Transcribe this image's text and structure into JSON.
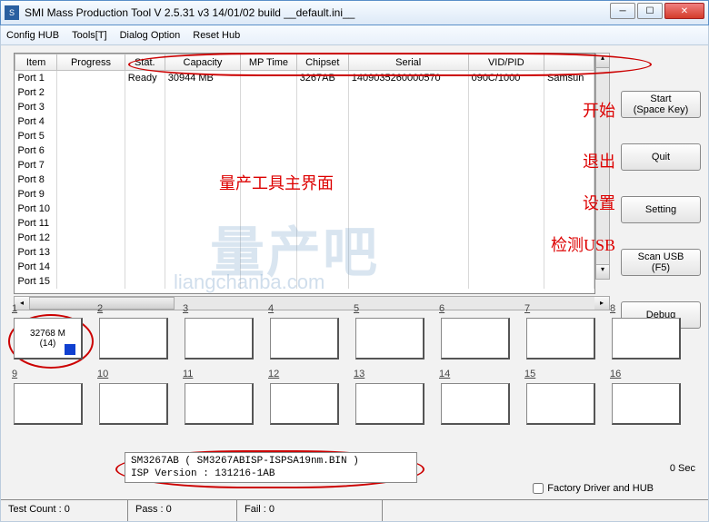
{
  "window": {
    "title": "SMI Mass Production Tool        V 2.5.31   v3        14/01/02 build        __default.ini__"
  },
  "menu": {
    "config_hub": "Config HUB",
    "tools": "Tools[T]",
    "dialog_option": "Dialog Option",
    "reset_hub": "Reset Hub"
  },
  "table": {
    "headers": [
      "Item",
      "Progress",
      "Stat.",
      "Capacity",
      "MP Time",
      "Chipset",
      "Serial",
      "VID/PID",
      ""
    ],
    "rows": [
      {
        "item": "Port 1",
        "progress": "",
        "stat": "Ready",
        "capacity": "30944 MB",
        "mp_time": "",
        "chipset": "3267AB",
        "serial": "1409035260000570",
        "vidpid": "090C/1000",
        "extra": "Samsun"
      },
      {
        "item": "Port 2"
      },
      {
        "item": "Port 3"
      },
      {
        "item": "Port 4"
      },
      {
        "item": "Port 5"
      },
      {
        "item": "Port 6"
      },
      {
        "item": "Port 7"
      },
      {
        "item": "Port 8"
      },
      {
        "item": "Port 9"
      },
      {
        "item": "Port 10"
      },
      {
        "item": "Port 11"
      },
      {
        "item": "Port 12"
      },
      {
        "item": "Port 13"
      },
      {
        "item": "Port 14"
      },
      {
        "item": "Port 15"
      }
    ]
  },
  "annotations": {
    "main_ui": "量产工具主界面",
    "start": "开始",
    "quit": "退出",
    "setting": "设置",
    "scan": "检测USB"
  },
  "buttons": {
    "start": "Start\n(Space Key)",
    "quit": "Quit",
    "setting": "Setting",
    "scan": "Scan USB\n(F5)",
    "debug": "Debug"
  },
  "slots": {
    "numbers": [
      "1",
      "2",
      "3",
      "4",
      "5",
      "6",
      "7",
      "8",
      "9",
      "10",
      "11",
      "12",
      "13",
      "14",
      "15",
      "16"
    ],
    "first": {
      "line1": "32768 M",
      "line2": "(14)"
    }
  },
  "info": {
    "line1": "SM3267AB        ( SM3267ABISP-ISPSA19nm.BIN )",
    "line2": "ISP Version :         131216-1AB"
  },
  "sec": "0 Sec",
  "factory": "Factory Driver and HUB",
  "status": {
    "test_count": "Test Count : 0",
    "pass": "Pass : 0",
    "fail": "Fail : 0"
  },
  "watermark": {
    "big": "量产吧",
    "small": "liangchanba.com"
  }
}
